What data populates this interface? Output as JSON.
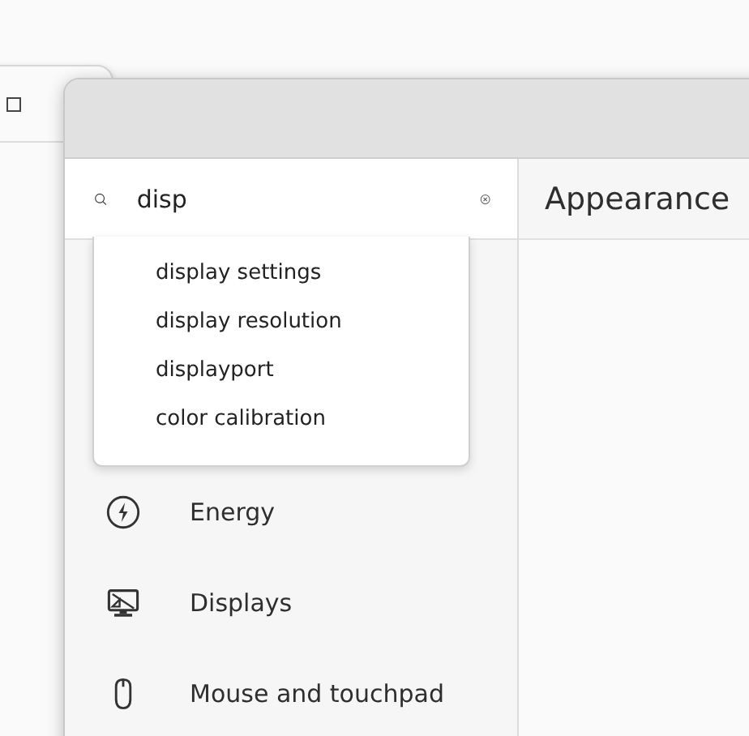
{
  "search": {
    "value": "disp"
  },
  "suggestions": [
    {
      "label": "display settings"
    },
    {
      "label": "display resolution"
    },
    {
      "label": "displayport"
    },
    {
      "label": "color calibration"
    }
  ],
  "sidebar": {
    "items": [
      {
        "label": "Energy",
        "kind": "energy"
      },
      {
        "label": "Displays",
        "kind": "displays"
      },
      {
        "label": "Mouse and touchpad",
        "kind": "mouse"
      }
    ]
  },
  "content": {
    "title": "Appearance"
  }
}
